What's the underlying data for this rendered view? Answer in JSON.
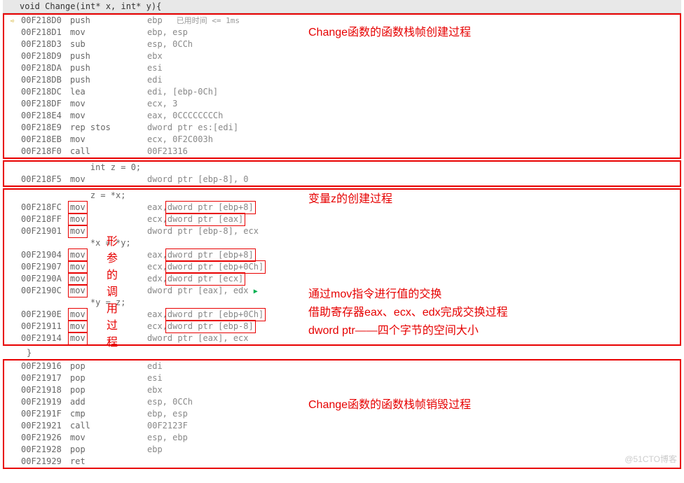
{
  "func_title": "void Change(int* x, int* y){",
  "time_hint": "已用时间 <= 1ms",
  "annotation1": "Change函数的函数栈帧创建过程",
  "annotation2": "变量z的创建过程",
  "annotation3a": "通过mov指令进行值的交换",
  "annotation3b": "借助寄存器eax、ecx、edx完成交换过程",
  "annotation3c": "dword ptr——四个字节的空间大小",
  "annotation4": "Change函数的函数栈帧销毁过程",
  "vert_annotation": [
    "形",
    "参",
    "的",
    "调",
    "用",
    "过",
    "程"
  ],
  "box1": [
    {
      "addr": "00F218D0",
      "m": "push",
      "op": "ebp",
      "hint": true
    },
    {
      "addr": "00F218D1",
      "m": "mov",
      "op": "ebp, esp"
    },
    {
      "addr": "00F218D3",
      "m": "sub",
      "op": "esp, 0CCh"
    },
    {
      "addr": "00F218D9",
      "m": "push",
      "op": "ebx"
    },
    {
      "addr": "00F218DA",
      "m": "push",
      "op": "esi"
    },
    {
      "addr": "00F218DB",
      "m": "push",
      "op": "edi"
    },
    {
      "addr": "00F218DC",
      "m": "lea",
      "op": "edi, [ebp-0Ch]"
    },
    {
      "addr": "00F218DF",
      "m": "mov",
      "op": "ecx, 3"
    },
    {
      "addr": "00F218E4",
      "m": "mov",
      "op": "eax, 0CCCCCCCCh"
    },
    {
      "addr": "00F218E9",
      "m": "rep stos",
      "op": "dword ptr es:[edi]"
    },
    {
      "addr": "00F218EB",
      "m": "mov",
      "op": "ecx, 0F2C003h"
    },
    {
      "addr": "00F218F0",
      "m": "call",
      "op": "00F21316"
    }
  ],
  "box2_l1": "    int z = 0;",
  "box2_l2": {
    "addr": "00F218F5",
    "m": "mov",
    "op": "dword ptr [ebp-8], 0"
  },
  "box3_src1": "    z = *x;",
  "box3_r1": {
    "addr": "00F218FC",
    "m": "mov",
    "op1": "eax,",
    "op2": "dword ptr [ebp+8]"
  },
  "box3_r2": {
    "addr": "00F218FF",
    "m": "mov",
    "op1": "ecx,",
    "op2": "dword ptr [eax]"
  },
  "box3_r3": {
    "addr": "00F21901",
    "m": "mov",
    "op": "dword ptr [ebp-8], ecx"
  },
  "box3_src2": "    *x = *y;",
  "box3_r4": {
    "addr": "00F21904",
    "m": "mov",
    "op1": "eax,",
    "op2": "dword ptr [ebp+8]"
  },
  "box3_r5": {
    "addr": "00F21907",
    "m": "mov",
    "op1": "ecx,",
    "op2": "dword ptr [ebp+0Ch]"
  },
  "box3_r6": {
    "addr": "00F2190A",
    "m": "mov",
    "op1": "edx,",
    "op2": "dword ptr [ecx]"
  },
  "box3_r7": {
    "addr": "00F2190C",
    "m": "mov",
    "op": "dword ptr [eax], edx"
  },
  "box3_src3": "    *y = z;",
  "box3_r8": {
    "addr": "00F2190E",
    "m": "mov",
    "op1": "eax,",
    "op2": "dword ptr [ebp+0Ch]"
  },
  "box3_r9": {
    "addr": "00F21911",
    "m": "mov",
    "op1": "ecx,",
    "op2": "dword ptr [ebp-8]"
  },
  "box3_r10": {
    "addr": "00F21914",
    "m": "mov",
    "op": "dword ptr [eax], ecx"
  },
  "brace": "}",
  "box4": [
    {
      "addr": "00F21916",
      "m": "pop",
      "op": "edi"
    },
    {
      "addr": "00F21917",
      "m": "pop",
      "op": "esi"
    },
    {
      "addr": "00F21918",
      "m": "pop",
      "op": "ebx"
    },
    {
      "addr": "00F21919",
      "m": "add",
      "op": "esp, 0CCh"
    },
    {
      "addr": "00F2191F",
      "m": "cmp",
      "op": "ebp, esp"
    },
    {
      "addr": "00F21921",
      "m": "call",
      "op": "00F2123F"
    },
    {
      "addr": "00F21926",
      "m": "mov",
      "op": "esp, ebp"
    },
    {
      "addr": "00F21928",
      "m": "pop",
      "op": "ebp"
    },
    {
      "addr": "00F21929",
      "m": "ret",
      "op": ""
    }
  ],
  "watermark": "@51CTO博客"
}
